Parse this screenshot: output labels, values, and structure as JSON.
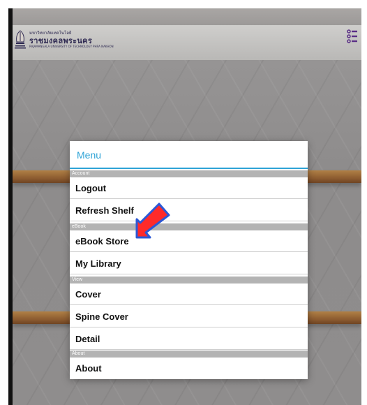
{
  "header": {
    "logo_small": "มหาวิทยาลัยเทคโนโลยี",
    "logo_title": "ราชมงคลพระนคร",
    "logo_caption": "RAJAMANGALA UNIVERSITY OF TECHNOLOGY PHRA NAKHON",
    "menu_icon": "list-menu-icon"
  },
  "dialog": {
    "title": "Menu",
    "sections": [
      {
        "title": "Account",
        "items": [
          {
            "label": "Logout"
          },
          {
            "label": "Refresh Shelf"
          }
        ]
      },
      {
        "title": "eBook",
        "items": [
          {
            "label": "eBook Store"
          },
          {
            "label": "My Library"
          }
        ]
      },
      {
        "title": "View",
        "items": [
          {
            "label": "Cover"
          },
          {
            "label": "Spine Cover"
          },
          {
            "label": "Detail"
          }
        ]
      },
      {
        "title": "About",
        "items": [
          {
            "label": "About"
          }
        ]
      }
    ]
  },
  "annotation": {
    "arrow_icon": "red-arrow-annotation-icon",
    "color": "#ff2a2a"
  },
  "colors": {
    "accent": "#2ea3d6",
    "section_bg": "#b3b3b3",
    "shelf_wood": "#8b5a2f"
  }
}
